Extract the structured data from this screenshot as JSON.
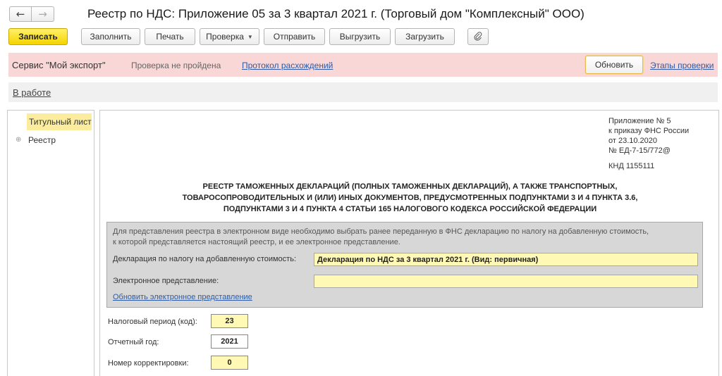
{
  "window": {
    "back_icon": "←",
    "forward_icon": "→",
    "title": "Реестр по НДС: Приложение 05 за 3 квартал 2021 г. (Торговый дом \"Комплексный\" ООО)"
  },
  "toolbar": {
    "save_label": "Записать",
    "fill_label": "Заполнить",
    "print_label": "Печать",
    "check_label": "Проверка",
    "send_label": "Отправить",
    "export_label": "Выгрузить",
    "load_label": "Загрузить",
    "attach_icon": "paperclip-icon"
  },
  "banner": {
    "service": "Сервис \"Мой экспорт\"",
    "status": "Проверка не пройдена",
    "protocol_link": "Протокол расхождений",
    "refresh_label": "Обновить",
    "stages_link": "Этапы проверки"
  },
  "workstatus": {
    "label": "В работе"
  },
  "sidebar": {
    "items": [
      {
        "label": "Титульный лист"
      },
      {
        "label": "Реестр"
      }
    ]
  },
  "document": {
    "ref_line1": "Приложение № 5",
    "ref_line2": "к приказу ФНС России",
    "ref_line3": "от 23.10.2020",
    "ref_line4": "№ ЕД-7-15/772@",
    "knd": "КНД 1155111",
    "heading_line1": "РЕЕСТР ТАМОЖЕННЫХ ДЕКЛАРАЦИЙ (ПОЛНЫХ ТАМОЖЕННЫХ ДЕКЛАРАЦИЙ), А ТАКЖЕ ТРАНСПОРТНЫХ,",
    "heading_line2": "ТОВАРОСОПРОВОДИТЕЛЬНЫХ И (ИЛИ) ИНЫХ ДОКУМЕНТОВ, ПРЕДУСМОТРЕННЫХ ПОДПУНКТАМИ 3 И 4 ПУНКТА 3.6,",
    "heading_line3": "ПОДПУНКТАМИ 3 И 4 ПУНКТА 4 СТАТЬИ 165 НАЛОГОВОГО КОДЕКСА РОССИЙСКОЙ ФЕДЕРАЦИИ",
    "note_line1": "Для представления реестра в электронном виде необходимо выбрать ранее переданную в ФНС декларацию по налогу на добавленную стоимость,",
    "note_line2": "к которой представляется настоящий реестр, и ее электронное представление.",
    "declaration_label": "Декларация по налогу на добавленную стоимость:",
    "declaration_value": "Декларация по НДС за 3 квартал 2021 г. (Вид: первичная)",
    "eform_label": "Электронное представление:",
    "eform_value": "",
    "update_link": "Обновить электронное представление",
    "period_label": "Налоговый период (код):",
    "period_value": "23",
    "year_label": "Отчетный год:",
    "year_value": "2021",
    "correction_label": "Номер корректировки:",
    "correction_value": "0"
  }
}
